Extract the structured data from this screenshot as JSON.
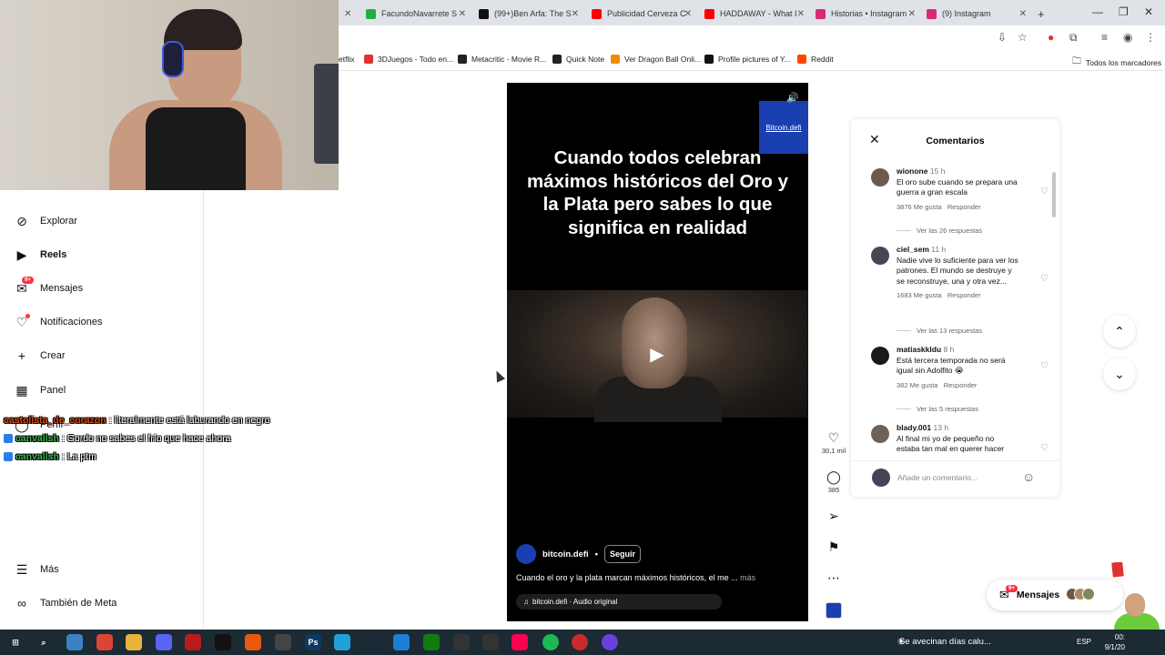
{
  "browser": {
    "tabs": [
      {
        "title": "FacundoNavarrete S",
        "color": "#1fb141"
      },
      {
        "title": "(99+)Ben Arfa: The S",
        "color": "#111111"
      },
      {
        "title": "Publicidad Cerveza C",
        "color": "#ff0000"
      },
      {
        "title": "HADDAWAY - What I",
        "color": "#ff0000"
      },
      {
        "title": "Historias • Instagram",
        "color": "#d62976"
      },
      {
        "title": "(9) Instagram",
        "color": "#d62976"
      }
    ],
    "new_tab": "+",
    "bookmarks": [
      {
        "label": "etflix",
        "color": "#e50914"
      },
      {
        "label": "3DJuegos - Todo en...",
        "color": "#e03131"
      },
      {
        "label": "Metacritic - Movie R...",
        "color": "#222222"
      },
      {
        "label": "Quick Note",
        "color": "#222222"
      },
      {
        "label": "Ver Dragon Ball Onli...",
        "color": "#f08c00"
      },
      {
        "label": "Profile pictures of Y...",
        "color": "#111111"
      },
      {
        "label": "Reddit",
        "color": "#ff4500"
      }
    ],
    "all_bookmarks": "Todos los marcadores"
  },
  "sidebar": {
    "items": [
      {
        "label": "Explorar",
        "icon": "compass-icon",
        "bold": false
      },
      {
        "label": "Reels",
        "icon": "reels-icon",
        "bold": true
      },
      {
        "label": "Mensajes",
        "icon": "messenger-icon",
        "bold": false,
        "badge": "9+"
      },
      {
        "label": "Notificaciones",
        "icon": "heart-icon",
        "bold": false
      },
      {
        "label": "Crear",
        "icon": "plus-icon",
        "bold": false
      },
      {
        "label": "Panel",
        "icon": "chart-icon",
        "bold": false
      },
      {
        "label": "Perfil",
        "icon": "profile-icon",
        "bold": false
      }
    ],
    "more": "Más",
    "meta": "También de Meta"
  },
  "chat": [
    {
      "user": "castolista_de_corazon",
      "user_color": "#d9480f",
      "message": ": literalmente está laburando en negro",
      "badge": false
    },
    {
      "user": "canvallsh",
      "user_color": "#37b24d",
      "message": ": Gordo no sabes el frío que hace ahora",
      "badge": true
    },
    {
      "user": "canvallsh",
      "user_color": "#37b24d",
      "message": ": La ptm",
      "badge": true
    }
  ],
  "reel": {
    "brand": "Bitcoin.defi",
    "headline": "Cuando todos celebran máximos históricos del Oro y la Plata pero sabes lo que significa en realidad",
    "author": "bitcoin.defi",
    "separator": "•",
    "follow": "Seguir",
    "caption": "Cuando el oro y la plata marcan máximos históricos, el me ...",
    "more": "más",
    "audio": "bitcoin.defi · Audio original"
  },
  "actions": {
    "likes": "30,1 mil",
    "comments": "385"
  },
  "comments_panel": {
    "title": "Comentarios",
    "comments": [
      {
        "user": "wionone",
        "time": "15 h",
        "text": "El oro sube cuando se prepara una guerra a gran escala",
        "likes": "3876 Me gusta",
        "reply": "Responder",
        "replies": "Ver las 26 respuestas",
        "avatar": "#6d5a4e"
      },
      {
        "user": "ciel_sem",
        "time": "11 h",
        "text": "Nadie vive lo suficiente para ver los patrones. El mundo se destruye y se reconstruye, una y otra vez...",
        "likes": "1683 Me gusta",
        "reply": "Responder",
        "replies": "Ver las 13 respuestas",
        "avatar": "#4b4451"
      },
      {
        "user": "matiaskkldu",
        "time": "8 h",
        "text": "Está tercera temporada no será igual sin Adolfito 😭",
        "likes": "382 Me gusta",
        "reply": "Responder",
        "replies": "Ver las 5 respuestas",
        "avatar": "#1a1a1a"
      },
      {
        "user": "blady.001",
        "time": "13 h",
        "text": "Al final mi yo de pequeño no estaba tan mal en querer hacer",
        "likes": "",
        "reply": "",
        "replies": "",
        "avatar": "#6e6258"
      }
    ],
    "input_placeholder": "Añade un comentario..."
  },
  "messages_pill": {
    "label": "Mensajes",
    "badge": "9+"
  },
  "taskbar": {
    "news": "Se avecinan días calu...",
    "lang": "ESP",
    "time": "00:",
    "date": "9/1/20"
  }
}
